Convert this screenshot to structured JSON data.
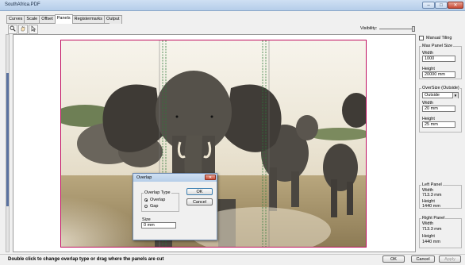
{
  "window": {
    "title": "SouthAfrica.PDF",
    "min": "–",
    "max": "□",
    "close": "✕"
  },
  "tabs": [
    {
      "label": "Curves",
      "active": false
    },
    {
      "label": "Scale",
      "active": false
    },
    {
      "label": "Offset",
      "active": false
    },
    {
      "label": "Panels",
      "active": true
    },
    {
      "label": "Registermarks",
      "active": false
    },
    {
      "label": "Output",
      "active": false
    }
  ],
  "toolbar": {
    "zoom_icon": "magnifier-icon",
    "hand_icon": "hand-icon",
    "pointer_icon": "pointer-icon"
  },
  "visibility": {
    "label": "Visibility:",
    "level": 0.95
  },
  "right_panel": {
    "manual_tiling_label": "Manual Tiling",
    "max_panel_size": {
      "title": "Max Panel Size",
      "width_label": "Width",
      "width_value": "1000",
      "height_label": "Height",
      "height_value": "20000 mm"
    },
    "oversize": {
      "title": "OverSize (Outside)",
      "mode_value": "Outside",
      "width_label": "Width",
      "width_value": "20 mm",
      "height_label": "Height",
      "height_value": "25 mm"
    },
    "left_panel": {
      "title": "Left Panel",
      "width_label": "Width",
      "width_value": "713.3 mm",
      "height_label": "Height",
      "height_value": "1440 mm"
    },
    "right_panel": {
      "title": "Right Panel",
      "width_label": "Width",
      "width_value": "713.3 mm",
      "height_label": "Height",
      "height_value": "1440 mm"
    }
  },
  "dialog": {
    "title": "Overlap",
    "overlap_type_title": "Overlap Type",
    "option_overlap": "Overlap",
    "option_gap": "Gap",
    "selected": "Overlap",
    "size_label": "Size",
    "size_value": "0 mm",
    "ok_label": "OK",
    "cancel_label": "Cancel",
    "close": "✕"
  },
  "status": {
    "message": "Double click to change overlap type or drag where the panels are cut",
    "ok_label": "OK",
    "cancel_label": "Cancel",
    "apply_label": "Apply"
  },
  "colors": {
    "accent": "#5a72a0",
    "panel_border": "#c01060",
    "cut_line": "#2f7a3a"
  }
}
